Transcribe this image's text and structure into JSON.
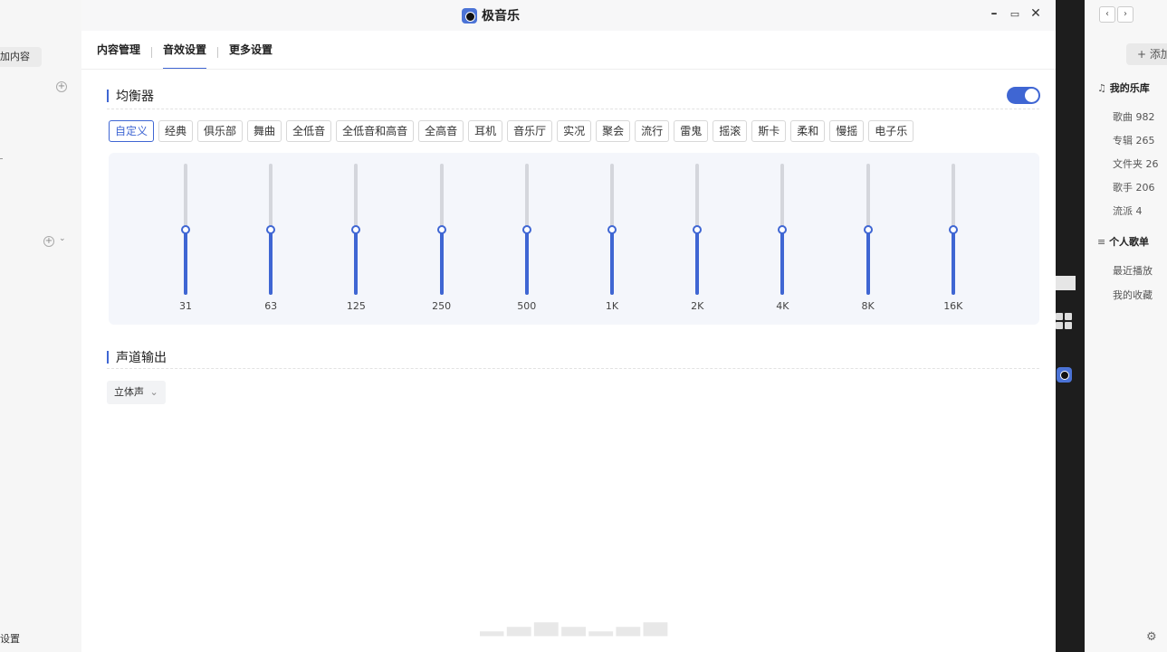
{
  "left_window": {
    "add_content_label": "加内容",
    "settings_label": "设置"
  },
  "window": {
    "title": "极音乐",
    "icons": [
      "app-logo-icon",
      "minimize-icon",
      "maximize-icon",
      "close-icon"
    ]
  },
  "tabs": [
    {
      "label": "内容管理",
      "active": false
    },
    {
      "label": "音效设置",
      "active": true
    },
    {
      "label": "更多设置",
      "active": false
    }
  ],
  "equalizer": {
    "title": "均衡器",
    "enabled": true,
    "presets": [
      "自定义",
      "经典",
      "俱乐部",
      "舞曲",
      "全低音",
      "全低音和高音",
      "全高音",
      "耳机",
      "音乐厅",
      "实况",
      "聚会",
      "流行",
      "雷鬼",
      "摇滚",
      "斯卡",
      "柔和",
      "慢摇",
      "电子乐"
    ],
    "active_preset": "自定义",
    "bands": [
      {
        "freq": "31",
        "level": 0.5
      },
      {
        "freq": "63",
        "level": 0.5
      },
      {
        "freq": "125",
        "level": 0.5
      },
      {
        "freq": "250",
        "level": 0.5
      },
      {
        "freq": "500",
        "level": 0.5
      },
      {
        "freq": "1K",
        "level": 0.5
      },
      {
        "freq": "2K",
        "level": 0.5
      },
      {
        "freq": "4K",
        "level": 0.5
      },
      {
        "freq": "8K",
        "level": 0.5
      },
      {
        "freq": "16K",
        "level": 0.5
      }
    ]
  },
  "channel": {
    "title": "声道输出",
    "selected": "立体声"
  },
  "right_window": {
    "add_label": "+ 添加",
    "library_title": "我的乐库",
    "library_items": [
      {
        "label": "歌曲",
        "count": "982"
      },
      {
        "label": "专辑",
        "count": "265"
      },
      {
        "label": "文件夹",
        "count": "26"
      },
      {
        "label": "歌手",
        "count": "206"
      },
      {
        "label": "流派",
        "count": "4"
      }
    ],
    "playlist_title": "个人歌单",
    "playlist_items": [
      "最近播放",
      "我的收藏"
    ]
  },
  "colors": {
    "accent": "#3f66d3",
    "panel_bg": "#f4f6fb"
  }
}
